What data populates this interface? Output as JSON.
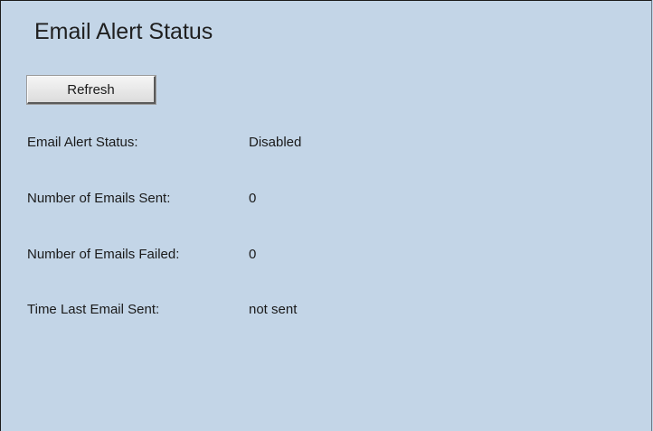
{
  "page": {
    "title": "Email Alert Status"
  },
  "toolbar": {
    "refresh_label": "Refresh"
  },
  "status": {
    "rows": [
      {
        "label": "Email Alert Status:",
        "value": "Disabled"
      },
      {
        "label": "Number of Emails Sent:",
        "value": "0"
      },
      {
        "label": "Number of Emails Failed:",
        "value": "0"
      },
      {
        "label": "Time Last Email Sent:",
        "value": "not sent"
      }
    ]
  },
  "colors": {
    "background": "#c3d5e7",
    "text": "#1a1a1a",
    "border": "#1b1b1b"
  }
}
